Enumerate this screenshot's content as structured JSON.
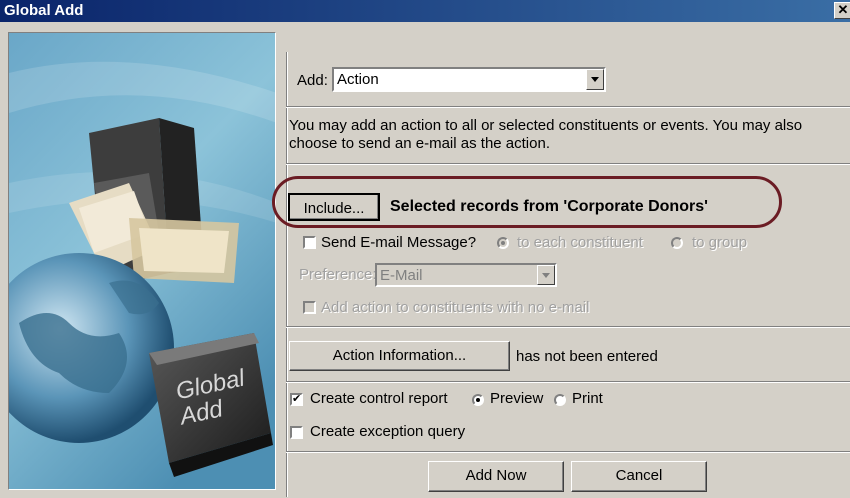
{
  "window": {
    "title": "Global Add",
    "close_label": "✕"
  },
  "image_panel": {
    "text_line1": "Global",
    "text_line2": "Add"
  },
  "add_field": {
    "label": "Add:",
    "value": "Action"
  },
  "description": "You may add an action to all or selected constituents or events.  You may also choose to send an e-mail as the action.",
  "include": {
    "button_label": "Include...",
    "selection_text": "Selected records from 'Corporate Donors'"
  },
  "email": {
    "checkbox_label": "Send E-mail Message?",
    "radio_each": "to each constituent",
    "radio_group": "to group",
    "preference_label": "Preference:",
    "preference_value": "E-Mail",
    "no_email_label": "Add action to constituents with no e-mail"
  },
  "action_info": {
    "button_label": "Action Information...",
    "status_text": "has not been entered"
  },
  "control_report": {
    "label": "Create control report",
    "checked": true,
    "preview_label": "Preview",
    "print_label": "Print",
    "selected": "Preview"
  },
  "exception_query": {
    "label": "Create exception query",
    "checked": false
  },
  "footer": {
    "add_now_label": "Add Now",
    "cancel_label": "Cancel"
  },
  "colors": {
    "highlight_ring": "#6b1c24",
    "titlebar_start": "#0a246a",
    "titlebar_end": "#3a6ea5"
  }
}
